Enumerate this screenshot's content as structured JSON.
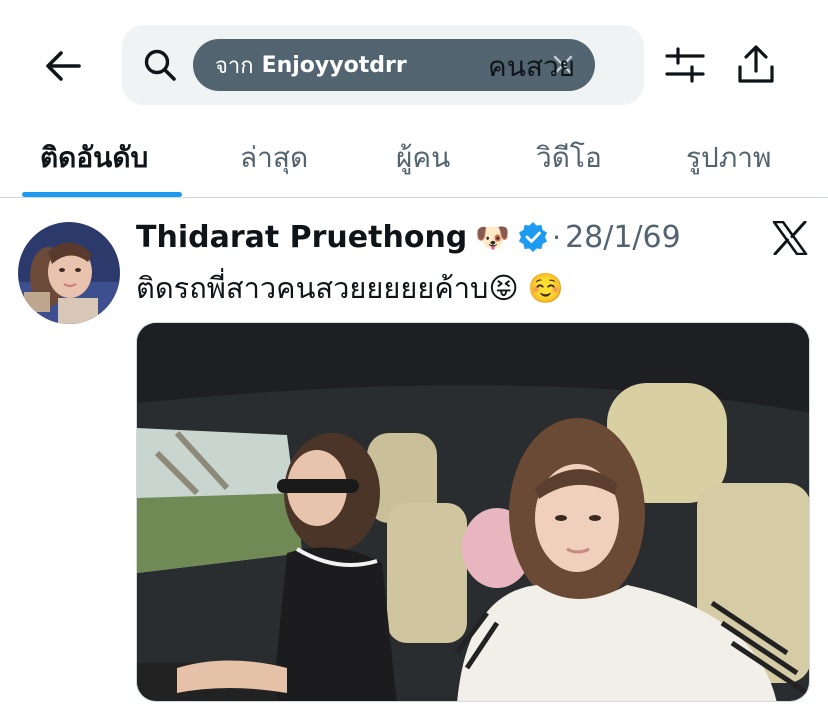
{
  "search": {
    "chip_prefix": "จาก",
    "chip_user": "Enjoyyotdrr",
    "query": "คนสวย"
  },
  "tabs": [
    {
      "label": "ติดอันดับ",
      "active": true
    },
    {
      "label": "ล่าสุด",
      "active": false
    },
    {
      "label": "ผู้คน",
      "active": false
    },
    {
      "label": "วิดีโอ",
      "active": false
    },
    {
      "label": "รูปภาพ",
      "active": false
    }
  ],
  "tweet": {
    "display_name": "Thidarat Pruethong",
    "name_emoji": "🐶",
    "separator": "·",
    "date": "28/1/69",
    "text": "ติดรถพี่สาวคนสวยยยยยค้าบ😝 ☺️"
  },
  "colors": {
    "accent": "#1d9bf0",
    "chip_bg": "#536471",
    "search_bg": "#eff3f4",
    "secondary_text": "#536471"
  },
  "icons": {
    "back": "arrow-left-icon",
    "search": "search-icon",
    "clear": "close-icon",
    "filter": "sliders-icon",
    "share": "share-icon",
    "verified": "verified-badge-icon",
    "platform": "x-logo-icon"
  }
}
